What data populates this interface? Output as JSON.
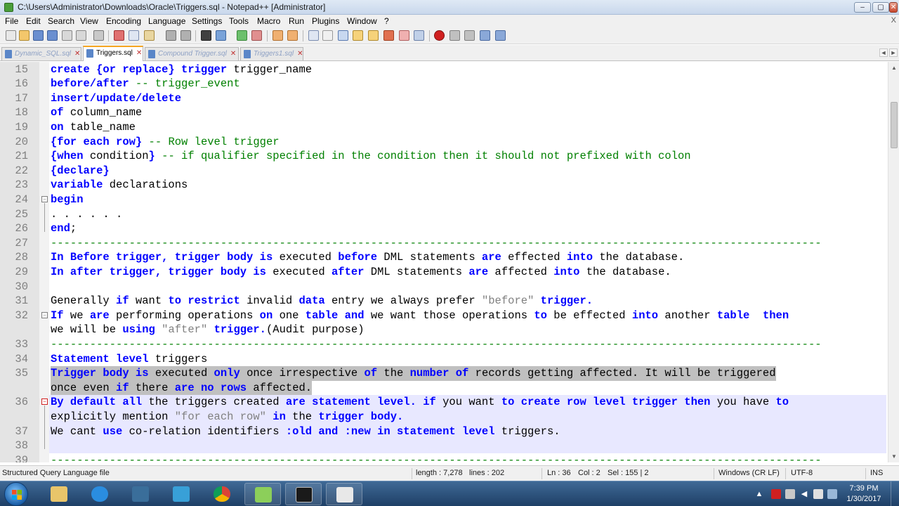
{
  "window": {
    "title": "C:\\Users\\Administrator\\Downloads\\Oracle\\Triggers.sql - Notepad++ [Administrator]",
    "minimize": "–",
    "maximize": "▢",
    "close": "✕"
  },
  "menu": {
    "items": [
      "File",
      "Edit",
      "Search",
      "View",
      "Encoding",
      "Language",
      "Settings",
      "Tools",
      "Macro",
      "Run",
      "Plugins",
      "Window",
      "?"
    ],
    "close_label": "X"
  },
  "tabs": [
    {
      "label": "Dynamic_SQL.sql",
      "active": false
    },
    {
      "label": "Triggers.sql",
      "active": true
    },
    {
      "label": "Compound Trigger.sql",
      "active": false
    },
    {
      "label": "Triggers1.sql",
      "active": false
    }
  ],
  "tab_close_glyph": "✕",
  "tab_nav": {
    "left": "◄",
    "right": "►"
  },
  "editor": {
    "lines": [
      {
        "num": "15",
        "segments": [
          [
            "kw",
            "create {or replace} trigger"
          ],
          [
            "tx",
            " trigger_name"
          ]
        ]
      },
      {
        "num": "16",
        "segments": [
          [
            "kw",
            "before/after"
          ],
          [
            "cm",
            " -- trigger_event"
          ]
        ]
      },
      {
        "num": "17",
        "segments": [
          [
            "kw",
            "insert/update/delete"
          ]
        ]
      },
      {
        "num": "18",
        "segments": [
          [
            "kw",
            "of"
          ],
          [
            "tx",
            " column_name"
          ]
        ]
      },
      {
        "num": "19",
        "segments": [
          [
            "kw",
            "on"
          ],
          [
            "tx",
            " table_name"
          ]
        ]
      },
      {
        "num": "20",
        "segments": [
          [
            "kw",
            "{for each row}"
          ],
          [
            "cm",
            " -- Row level trigger"
          ]
        ]
      },
      {
        "num": "21",
        "segments": [
          [
            "kw",
            "{when"
          ],
          [
            "tx",
            " condition"
          ],
          [
            "kw",
            "}"
          ],
          [
            "cm",
            " -- if qualifier specified in the condition then it should not prefixed with colon"
          ]
        ]
      },
      {
        "num": "22",
        "segments": [
          [
            "kw",
            "{declare}"
          ]
        ]
      },
      {
        "num": "23",
        "segments": [
          [
            "kw",
            "variable"
          ],
          [
            "tx",
            " declarations"
          ]
        ]
      },
      {
        "num": "24",
        "segments": [
          [
            "kw",
            "begin"
          ]
        ]
      },
      {
        "num": "25",
        "segments": [
          [
            "tx",
            ". . . . . ."
          ]
        ]
      },
      {
        "num": "26",
        "segments": [
          [
            "kw",
            "end"
          ],
          [
            "tx",
            ";"
          ]
        ]
      },
      {
        "num": "27",
        "segments": [
          [
            "sep",
            "----------------------------------------------------------------------------------------------------------------------"
          ]
        ]
      },
      {
        "num": "28",
        "segments": [
          [
            "kw",
            "In Before trigger, trigger body is"
          ],
          [
            "tx",
            " executed "
          ],
          [
            "kw",
            "before"
          ],
          [
            "tx",
            " DML statements "
          ],
          [
            "kw",
            "are"
          ],
          [
            "tx",
            " effected "
          ],
          [
            "kw",
            "into"
          ],
          [
            "tx",
            " the database."
          ]
        ]
      },
      {
        "num": "29",
        "segments": [
          [
            "kw",
            "In after trigger, trigger body is"
          ],
          [
            "tx",
            " executed "
          ],
          [
            "kw",
            "after"
          ],
          [
            "tx",
            " DML statements "
          ],
          [
            "kw",
            "are"
          ],
          [
            "tx",
            " affected "
          ],
          [
            "kw",
            "into"
          ],
          [
            "tx",
            " the database."
          ]
        ]
      },
      {
        "num": "30",
        "segments": []
      },
      {
        "num": "31",
        "segments": [
          [
            "tx",
            "Generally "
          ],
          [
            "kw",
            "if"
          ],
          [
            "tx",
            " want "
          ],
          [
            "kw",
            "to restrict"
          ],
          [
            "tx",
            " invalid "
          ],
          [
            "kw",
            "data"
          ],
          [
            "tx",
            " entry we always prefer "
          ],
          [
            "str",
            "\"before\""
          ],
          [
            "kw",
            " trigger."
          ]
        ]
      },
      {
        "num": "32",
        "segments": [
          [
            "kw",
            "If"
          ],
          [
            "tx",
            " we "
          ],
          [
            "kw",
            "are"
          ],
          [
            "tx",
            " performing operations "
          ],
          [
            "kw",
            "on"
          ],
          [
            "tx",
            " one "
          ],
          [
            "kw",
            "table and"
          ],
          [
            "tx",
            " we want those operations "
          ],
          [
            "kw",
            "to"
          ],
          [
            "tx",
            " be effected "
          ],
          [
            "kw",
            "into"
          ],
          [
            "tx",
            " another "
          ],
          [
            "kw",
            "table  then"
          ]
        ]
      },
      {
        "num": "",
        "segments": [
          [
            "tx",
            "we will be "
          ],
          [
            "kw",
            "using"
          ],
          [
            "str",
            " \"after\""
          ],
          [
            "kw",
            " trigger."
          ],
          [
            "tx",
            "(Audit purpose)"
          ]
        ]
      },
      {
        "num": "33",
        "segments": [
          [
            "sep",
            "----------------------------------------------------------------------------------------------------------------------"
          ]
        ]
      },
      {
        "num": "34",
        "segments": [
          [
            "kw",
            "Statement level"
          ],
          [
            "tx",
            " triggers"
          ]
        ]
      },
      {
        "num": "35",
        "segments": [
          [
            "kw",
            "Trigger body is"
          ],
          [
            "tx",
            " executed "
          ],
          [
            "kw",
            "only"
          ],
          [
            "tx",
            " once irrespective "
          ],
          [
            "kw",
            "of"
          ],
          [
            "tx",
            " the "
          ],
          [
            "kw",
            "number of"
          ],
          [
            "tx",
            " records getting affected. It will be triggered"
          ]
        ]
      },
      {
        "num": "",
        "segments": [
          [
            "tx",
            "once even "
          ],
          [
            "kw",
            "if"
          ],
          [
            "tx",
            " there "
          ],
          [
            "kw",
            "are no rows"
          ],
          [
            "tx",
            " affected."
          ]
        ]
      },
      {
        "num": "36",
        "segments": [
          [
            "kw",
            "By default all"
          ],
          [
            "tx",
            " the triggers created "
          ],
          [
            "kw",
            "are statement level. if"
          ],
          [
            "tx",
            " you want "
          ],
          [
            "kw",
            "to create row level trigger then"
          ],
          [
            "tx",
            " you have "
          ],
          [
            "kw",
            "to"
          ]
        ]
      },
      {
        "num": "",
        "segments": [
          [
            "tx",
            "explicitly mention "
          ],
          [
            "str",
            "\"for each row\""
          ],
          [
            "kw",
            " in"
          ],
          [
            "tx",
            " the "
          ],
          [
            "kw",
            "trigger body."
          ]
        ]
      },
      {
        "num": "37",
        "segments": [
          [
            "tx",
            "We cant "
          ],
          [
            "kw",
            "use"
          ],
          [
            "tx",
            " co-relation identifiers "
          ],
          [
            "kw",
            ":old and :new in statement level"
          ],
          [
            "tx",
            " triggers."
          ]
        ]
      },
      {
        "num": "38",
        "segments": []
      },
      {
        "num": "39",
        "segments": [
          [
            "sep",
            "----------------------------------------------------------------------------------------------------------------------"
          ]
        ]
      }
    ]
  },
  "status": {
    "file_type": "Structured Query Language file",
    "length": "length : 7,278",
    "lines": "lines : 202",
    "ln": "Ln : 36",
    "col": "Col : 2",
    "sel": "Sel : 155 | 2",
    "eol": "Windows (CR LF)",
    "encoding": "UTF-8",
    "mode": "INS"
  },
  "clock": {
    "time": "7:39 PM",
    "date": "1/30/2017"
  }
}
